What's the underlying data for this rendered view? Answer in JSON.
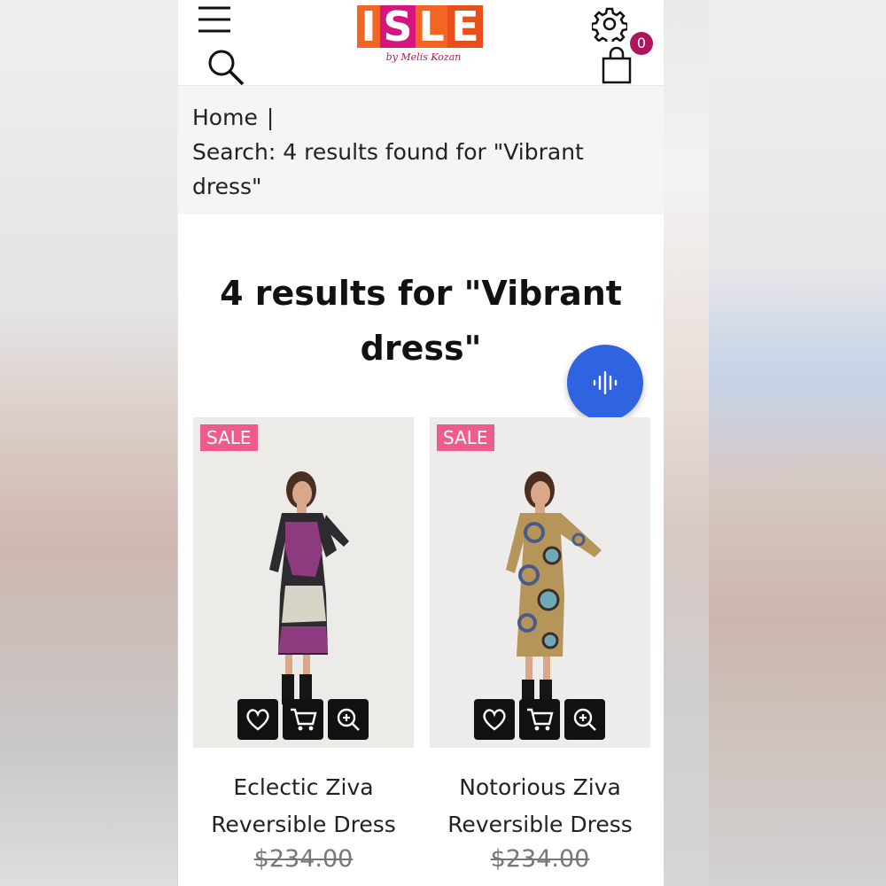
{
  "header": {
    "menu_icon": "hamburger-menu-icon",
    "search_icon": "search-icon",
    "settings_icon": "gear-icon",
    "cart_icon": "shopping-bag-icon",
    "cart_count": "0",
    "logo": {
      "letters": [
        "I",
        "S",
        "L",
        "E"
      ],
      "letter_colors": [
        "#f26522",
        "#d6157e",
        "#f26522",
        "#e94e1b"
      ],
      "tagline": "by Melis Kozan"
    }
  },
  "breadcrumb": {
    "home": "Home",
    "separator": "|",
    "current": "Search: 4 results found for \"Vibrant dress\""
  },
  "results_heading": "4 results for \"Vibrant dress\"",
  "voice_search": {
    "icon": "voice-waveform-icon",
    "color": "#2f63e0"
  },
  "products": [
    {
      "badge": "SALE",
      "name": "Eclectic Ziva Reversible Dress",
      "price": "$234.00",
      "dress_colors": [
        "#2a2a2a",
        "#8e3a7e",
        "#d9d4c8"
      ],
      "actions": [
        "heart-icon",
        "cart-icon",
        "zoom-in-icon"
      ]
    },
    {
      "badge": "SALE",
      "name": "Notorious Ziva Reversible Dress",
      "price": "$234.00",
      "dress_colors": [
        "#b6955a",
        "#4a5b8a",
        "#6fa9b8"
      ],
      "actions": [
        "heart-icon",
        "cart-icon",
        "zoom-in-icon"
      ]
    }
  ],
  "colors": {
    "brand_pink": "#d6157e",
    "brand_orange": "#f26522",
    "sale_badge": "#ee5b8c",
    "badge_count": "#b0145c"
  }
}
